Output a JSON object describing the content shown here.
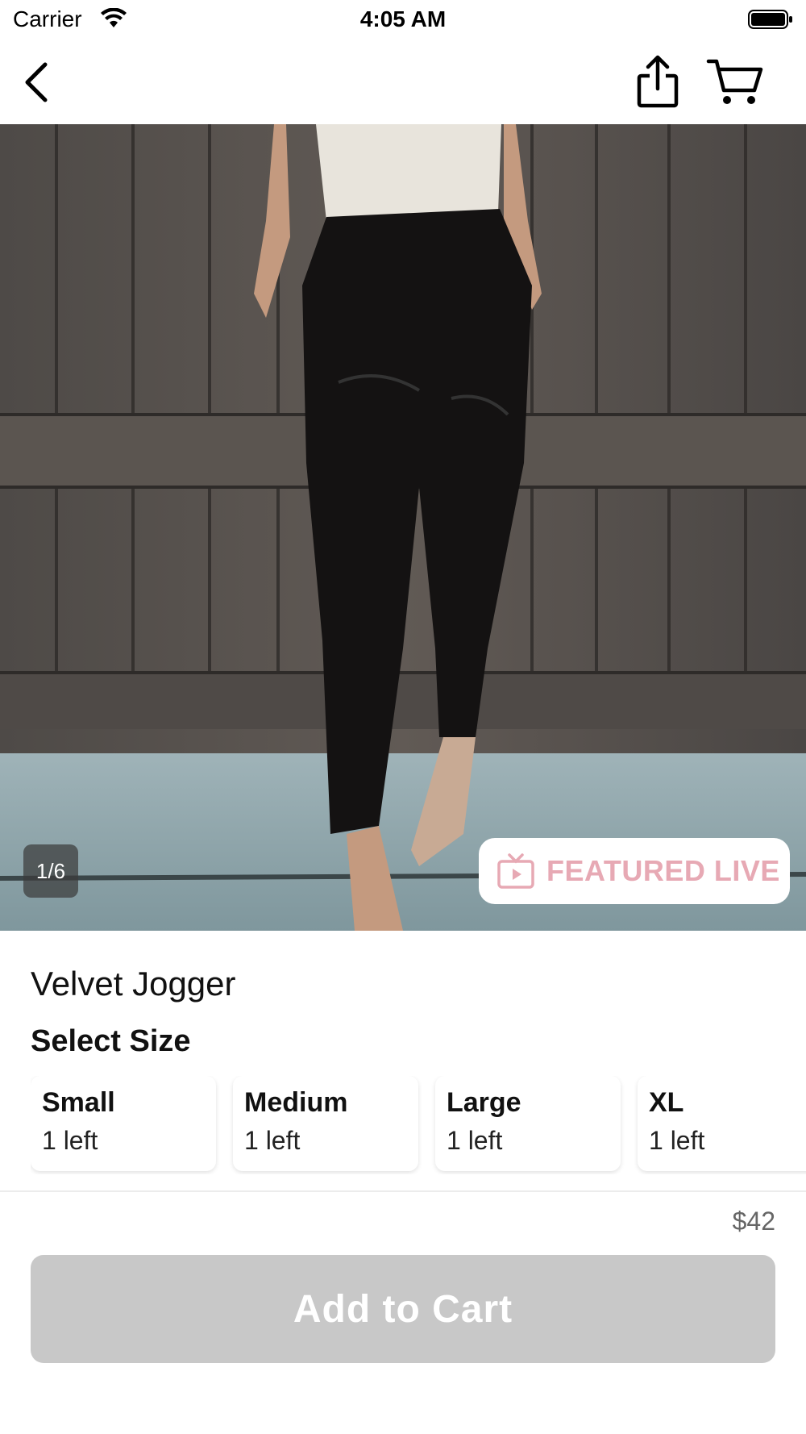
{
  "status_bar": {
    "carrier": "Carrier",
    "time": "4:05 AM",
    "icons": [
      "wifi-icon",
      "battery-icon"
    ]
  },
  "nav": {
    "icons": [
      "chevron-left-icon",
      "share-icon",
      "cart-icon"
    ]
  },
  "gallery": {
    "counter": "1/6",
    "featured_live_label": "FEATURED LIVE",
    "featured_icon": "tv-play-icon",
    "featured_color": "#e7a9b4"
  },
  "product": {
    "title": "Velvet Jogger",
    "select_size_label": "Select Size",
    "sizes": [
      {
        "name": "Small",
        "stock": "1 left"
      },
      {
        "name": "Medium",
        "stock": "1 left"
      },
      {
        "name": "Large",
        "stock": "1 left"
      },
      {
        "name": "XL",
        "stock": "1 left"
      }
    ],
    "price": "$42"
  },
  "actions": {
    "add_to_cart_label": "Add to Cart",
    "add_to_cart_color": "#c8c8c8"
  }
}
